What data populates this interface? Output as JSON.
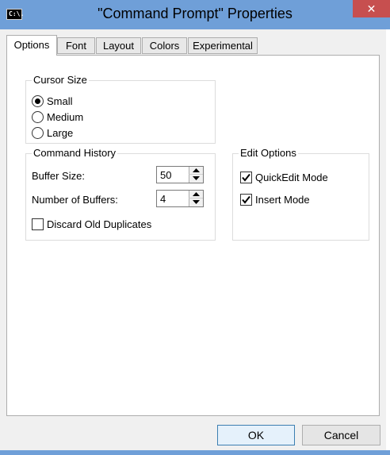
{
  "window": {
    "title": "\"Command Prompt\" Properties",
    "icon_text": "C:\\.",
    "close_symbol": "✕"
  },
  "tabs": [
    {
      "label": "Options",
      "active": true
    },
    {
      "label": "Font",
      "active": false
    },
    {
      "label": "Layout",
      "active": false
    },
    {
      "label": "Colors",
      "active": false
    },
    {
      "label": "Experimental",
      "active": false
    }
  ],
  "cursor_size": {
    "title": "Cursor Size",
    "options": [
      {
        "label": "Small",
        "selected": true
      },
      {
        "label": "Medium",
        "selected": false
      },
      {
        "label": "Large",
        "selected": false
      }
    ]
  },
  "command_history": {
    "title": "Command History",
    "buffer_size_label": "Buffer Size:",
    "buffer_size_value": "50",
    "num_buffers_label": "Number of Buffers:",
    "num_buffers_value": "4",
    "discard_label": "Discard Old Duplicates",
    "discard_checked": false
  },
  "edit_options": {
    "title": "Edit Options",
    "quickedit_label": "QuickEdit Mode",
    "quickedit_checked": true,
    "insert_label": "Insert Mode",
    "insert_checked": true
  },
  "buttons": {
    "ok": "OK",
    "cancel": "Cancel"
  },
  "colors": {
    "titlebar": "#6f9fd8",
    "close": "#c74f4f",
    "dialog_bg": "#f0f0f0"
  }
}
